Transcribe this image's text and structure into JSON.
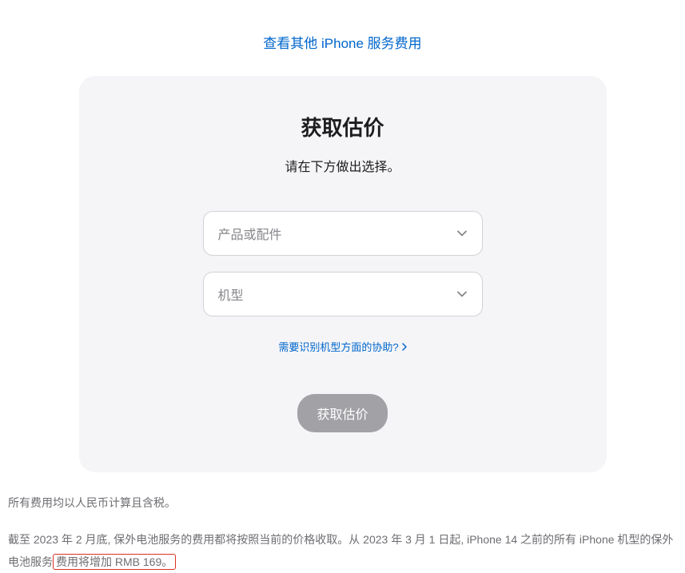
{
  "topLink": {
    "label": "查看其他 iPhone 服务费用"
  },
  "card": {
    "title": "获取估价",
    "subtitle": "请在下方做出选择。",
    "select1": {
      "placeholder": "产品或配件"
    },
    "select2": {
      "placeholder": "机型"
    },
    "helpLink": "需要识别机型方面的协助?",
    "buttonLabel": "获取估价"
  },
  "footer": {
    "line1": "所有费用均以人民币计算且含税。",
    "line2_pre": "截至 2023 年 2 月底, 保外电池服务的费用都将按照当前的价格收取。从 2023 年 3 月 1 日起, iPhone 14 之前的所有 iPhone 机型的保外电池服务",
    "line2_highlight": "费用将增加 RMB 169。"
  }
}
